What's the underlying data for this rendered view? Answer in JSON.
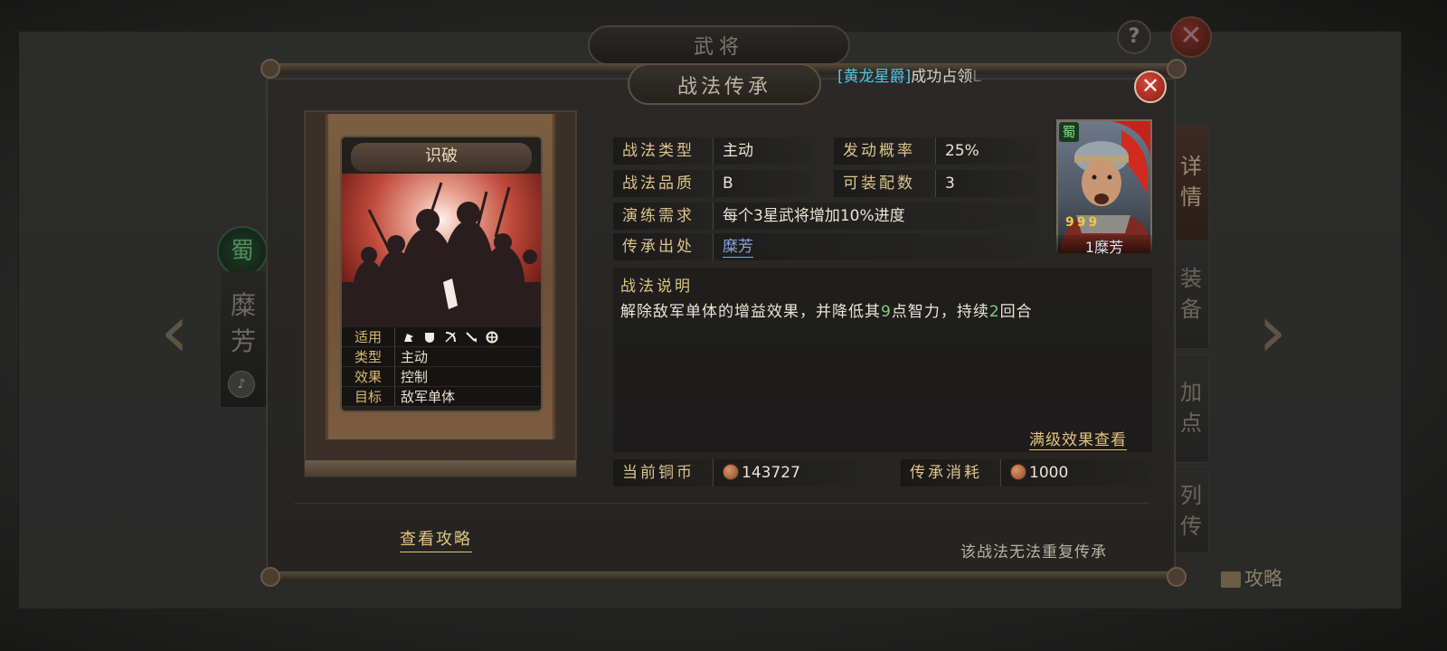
{
  "background": {
    "window_title": "武将",
    "help_label": "?",
    "close_label": "✕",
    "faction_seal": "蜀",
    "hero_name": "糜芳",
    "side_tabs": [
      "详情",
      "装备",
      "加点",
      "列传"
    ],
    "guide_label": "攻略"
  },
  "dialog": {
    "title": "战法传承",
    "close_label": "✕",
    "ticker": {
      "highlight": "[黄龙星爵]",
      "text": "成功占领",
      "fade": "L"
    }
  },
  "skill_card": {
    "name": "识破",
    "rows": [
      {
        "key": "适用",
        "icons": [
          "cavalry-icon",
          "shield-icon",
          "bow-icon",
          "spear-icon",
          "wheel-icon"
        ]
      },
      {
        "key": "类型",
        "value": "主动"
      },
      {
        "key": "效果",
        "value": "控制"
      },
      {
        "key": "目标",
        "value": "敌军单体"
      }
    ]
  },
  "info": {
    "type_label": "战法类型",
    "type_value": "主动",
    "rate_label": "发动概率",
    "rate_value": "25%",
    "quality_label": "战法品质",
    "quality_value": "B",
    "slots_label": "可装配数",
    "slots_value": "3",
    "req_label": "演练需求",
    "req_value": "每个3星武将增加10%进度",
    "source_label": "传承出处",
    "source_value": "糜芳"
  },
  "portrait": {
    "kingdom": "蜀",
    "stars": "999",
    "name": "1糜芳"
  },
  "description": {
    "label": "战法说明",
    "text_parts": [
      "解除敌军单体的增益效果，并降低其",
      "9",
      "点智力，持续",
      "2",
      "回合"
    ],
    "max_effect_link": "满级效果查看"
  },
  "cost": {
    "coins_label": "当前铜币",
    "coins_value": "143727",
    "consume_label": "传承消耗",
    "consume_value": "1000"
  },
  "footer": {
    "guide_link": "查看攻略",
    "note": "该战法无法重复传承"
  },
  "colors": {
    "gold_label": "#dcc48a",
    "link_blue": "#86a7d8",
    "highlight_cyan": "#4fc6e6",
    "number_green": "#7fd07a",
    "close_red": "#d6473a"
  }
}
